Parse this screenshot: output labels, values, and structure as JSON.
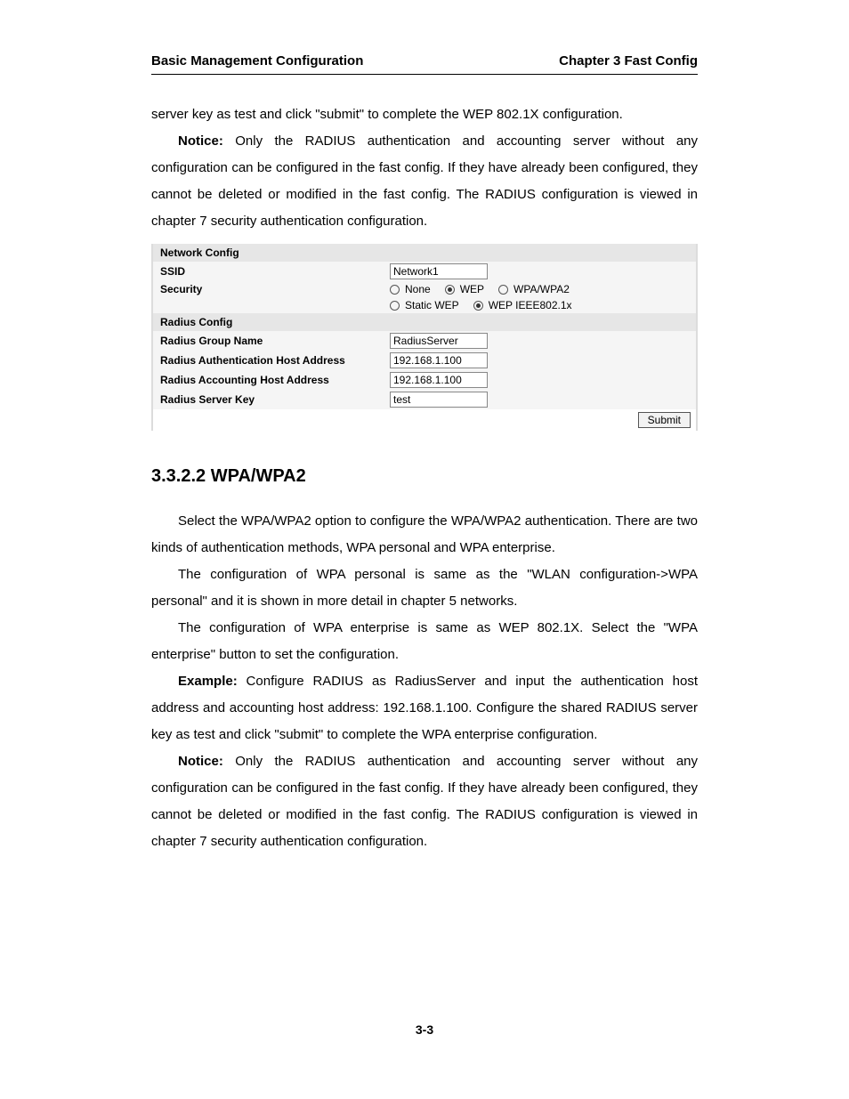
{
  "header": {
    "left": "Basic Management Configuration",
    "right": "Chapter 3 Fast Config"
  },
  "intro_paragraph": "server key as test and click \"submit\" to complete the WEP 802.1X configuration.",
  "notice_prefix": "Notice:",
  "notice_paragraph": " Only the RADIUS authentication and accounting server without any configuration can be configured in the fast config. If they have already been configured, they cannot be deleted or modified in the fast config. The RADIUS configuration is viewed in chapter 7 security authentication configuration.",
  "panel": {
    "network_config_title": "Network Config",
    "ssid_label": "SSID",
    "ssid_value": "Network1",
    "security_label": "Security",
    "security_options": {
      "none": "None",
      "wep": "WEP",
      "wpa": "WPA/WPA2",
      "static_wep": "Static WEP",
      "wep_8021x": "WEP IEEE802.1x"
    },
    "radius_config_title": "Radius Config",
    "radius_group_label": "Radius Group Name",
    "radius_group_value": "RadiusServer",
    "radius_auth_label": "Radius Authentication Host Address",
    "radius_auth_value": "192.168.1.100",
    "radius_acct_label": "Radius Accounting Host Address",
    "radius_acct_value": "192.168.1.100",
    "radius_key_label": "Radius Server Key",
    "radius_key_value": "test",
    "submit_label": "Submit"
  },
  "section_heading": "3.3.2.2 WPA/WPA2",
  "p1": "Select the WPA/WPA2 option to configure the WPA/WPA2 authentication. There are two kinds of authentication methods, WPA personal and WPA enterprise.",
  "p2": "The configuration of WPA personal is same as the \"WLAN configuration->WPA personal\" and it is shown in more detail in chapter 5 networks.",
  "p3": "The configuration of WPA enterprise is same as WEP 802.1X. Select the \"WPA enterprise\" button to set the configuration.",
  "example_prefix": "Example:",
  "p4": " Configure RADIUS as RadiusServer and input the authentication host address and accounting host address: 192.168.1.100. Configure the shared RADIUS server key as test and click \"submit\" to complete the WPA enterprise configuration.",
  "p5_prefix": "Notice:",
  "p5": " Only the RADIUS authentication and accounting server without any configuration can be configured in the fast config. If they have already been configured, they cannot be deleted or modified in the fast config. The RADIUS configuration is viewed in chapter 7 security authentication configuration.",
  "page_number": "3-3"
}
